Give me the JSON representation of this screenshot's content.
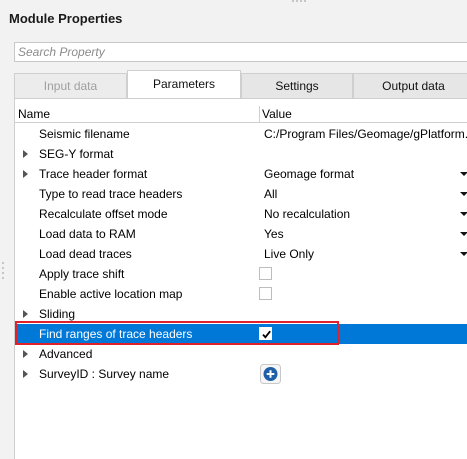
{
  "window": {
    "title": "Module Properties"
  },
  "search": {
    "placeholder": "Search Property",
    "value": ""
  },
  "tabs": [
    {
      "label": "Input data",
      "state": "disabled"
    },
    {
      "label": "Parameters",
      "state": "active"
    },
    {
      "label": "Settings",
      "state": "normal"
    },
    {
      "label": "Output data",
      "state": "normal"
    }
  ],
  "grid": {
    "headers": {
      "name": "Name",
      "value": "Value"
    },
    "rows": [
      {
        "name": "Seismic filename",
        "value": "C:/Program Files/Geomage/gPlatform..."
      },
      {
        "name": "SEG-Y format",
        "expandable": true
      },
      {
        "name": "Trace header format",
        "value": "Geomage format",
        "expandable": true,
        "dropdown": true
      },
      {
        "name": "Type to read trace headers",
        "value": "All",
        "dropdown": true
      },
      {
        "name": "Recalculate offset mode",
        "value": "No recalculation",
        "dropdown": true
      },
      {
        "name": "Load data to RAM",
        "value": "Yes",
        "dropdown": true
      },
      {
        "name": "Load dead traces",
        "value": "Live Only",
        "dropdown": true
      },
      {
        "name": "Apply trace shift",
        "checkbox": false
      },
      {
        "name": "Enable active location map",
        "checkbox": false
      },
      {
        "name": "Sliding",
        "expandable": true
      },
      {
        "name": "Find ranges of trace headers",
        "checkbox": true,
        "selected": true
      },
      {
        "name": "Advanced",
        "expandable": true
      },
      {
        "name": "SurveyID : Survey name",
        "expandable": true,
        "add_button": true
      }
    ]
  },
  "colors": {
    "selection": "#0078d7",
    "highlight_border": "#e0202a",
    "add_button": "#1f5fa8"
  },
  "icons": {
    "expand": "chevron-right-icon",
    "dropdown": "chevron-down-icon",
    "add": "plus-circle-icon",
    "check": "check-icon"
  }
}
